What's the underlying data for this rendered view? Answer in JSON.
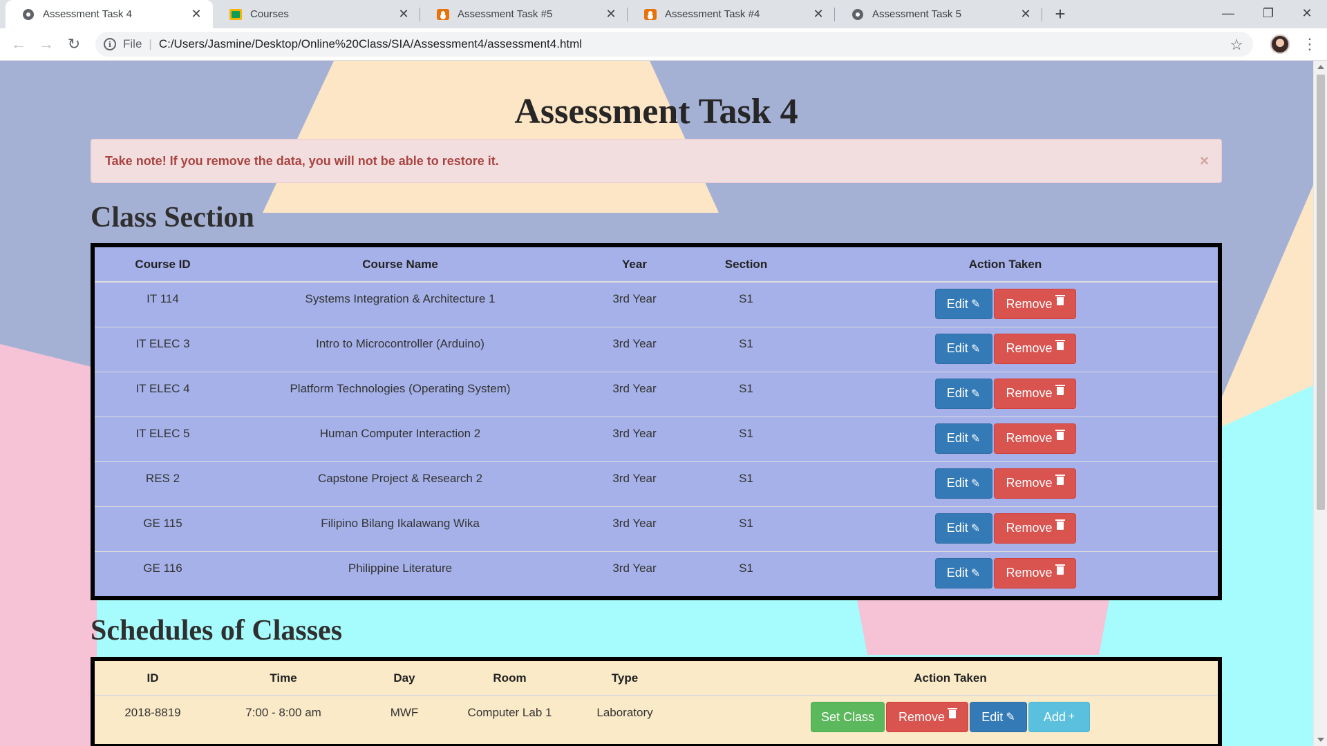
{
  "browser": {
    "tabs": [
      {
        "title": "Assessment Task 4",
        "icon": "globe-icon",
        "active": true
      },
      {
        "title": "Courses",
        "icon": "google-classroom-icon",
        "active": false
      },
      {
        "title": "Assessment Task #5",
        "icon": "google-forms-icon",
        "active": false
      },
      {
        "title": "Assessment Task #4",
        "icon": "google-forms-icon",
        "active": false
      },
      {
        "title": "Assessment Task 5",
        "icon": "globe-icon",
        "active": false
      }
    ],
    "new_tab_label": "+",
    "address": {
      "scheme_label": "File",
      "url": "C:/Users/Jasmine/Desktop/Online%20Class/SIA/Assessment4/assessment4.html"
    }
  },
  "page": {
    "title": "Assessment Task 4",
    "alert": {
      "text": "Take note! If you remove the data, you will not be able to restore it.",
      "close_label": "×"
    },
    "class_section": {
      "heading": "Class Section",
      "columns": [
        "Course ID",
        "Course Name",
        "Year",
        "Section",
        "Action Taken"
      ],
      "rows": [
        {
          "course_id": "IT 114",
          "course_name": "Systems Integration & Architecture 1",
          "year": "3rd Year",
          "section": "S1"
        },
        {
          "course_id": "IT ELEC 3",
          "course_name": "Intro to Microcontroller (Arduino)",
          "year": "3rd Year",
          "section": "S1"
        },
        {
          "course_id": "IT ELEC 4",
          "course_name": "Platform Technologies (Operating System)",
          "year": "3rd Year",
          "section": "S1"
        },
        {
          "course_id": "IT ELEC 5",
          "course_name": "Human Computer Interaction 2",
          "year": "3rd Year",
          "section": "S1"
        },
        {
          "course_id": "RES 2",
          "course_name": "Capstone Project & Research 2",
          "year": "3rd Year",
          "section": "S1"
        },
        {
          "course_id": "GE 115",
          "course_name": "Filipino Bilang Ikalawang Wika",
          "year": "3rd Year",
          "section": "S1"
        },
        {
          "course_id": "GE 116",
          "course_name": "Philippine Literature",
          "year": "3rd Year",
          "section": "S1"
        }
      ],
      "edit_label": "Edit",
      "remove_label": "Remove"
    },
    "schedules": {
      "heading": "Schedules of Classes",
      "columns": [
        "ID",
        "Time",
        "Day",
        "Room",
        "Type",
        "Action Taken"
      ],
      "rows": [
        {
          "id": "2018-8819",
          "time": "7:00 - 8:00 am",
          "day": "MWF",
          "room": "Computer Lab 1",
          "type": "Laboratory"
        }
      ],
      "set_class_label": "Set Class",
      "remove_label": "Remove",
      "edit_label": "Edit",
      "add_label": "Add"
    }
  },
  "colors": {
    "class_table_bg": "#a5b1e8",
    "schedule_table_bg": "#faeac8",
    "bg_periwinkle": "#a5b1d4",
    "bg_peach": "#fde6c5",
    "bg_pink": "#f5c2d6",
    "bg_cyan": "#a6fcfc",
    "alert_bg": "#f2dede",
    "alert_text": "#a94442",
    "btn_edit": "#337ab7",
    "btn_remove": "#d9534f",
    "btn_set_class": "#5cb85c",
    "btn_add": "#5bc0de"
  }
}
